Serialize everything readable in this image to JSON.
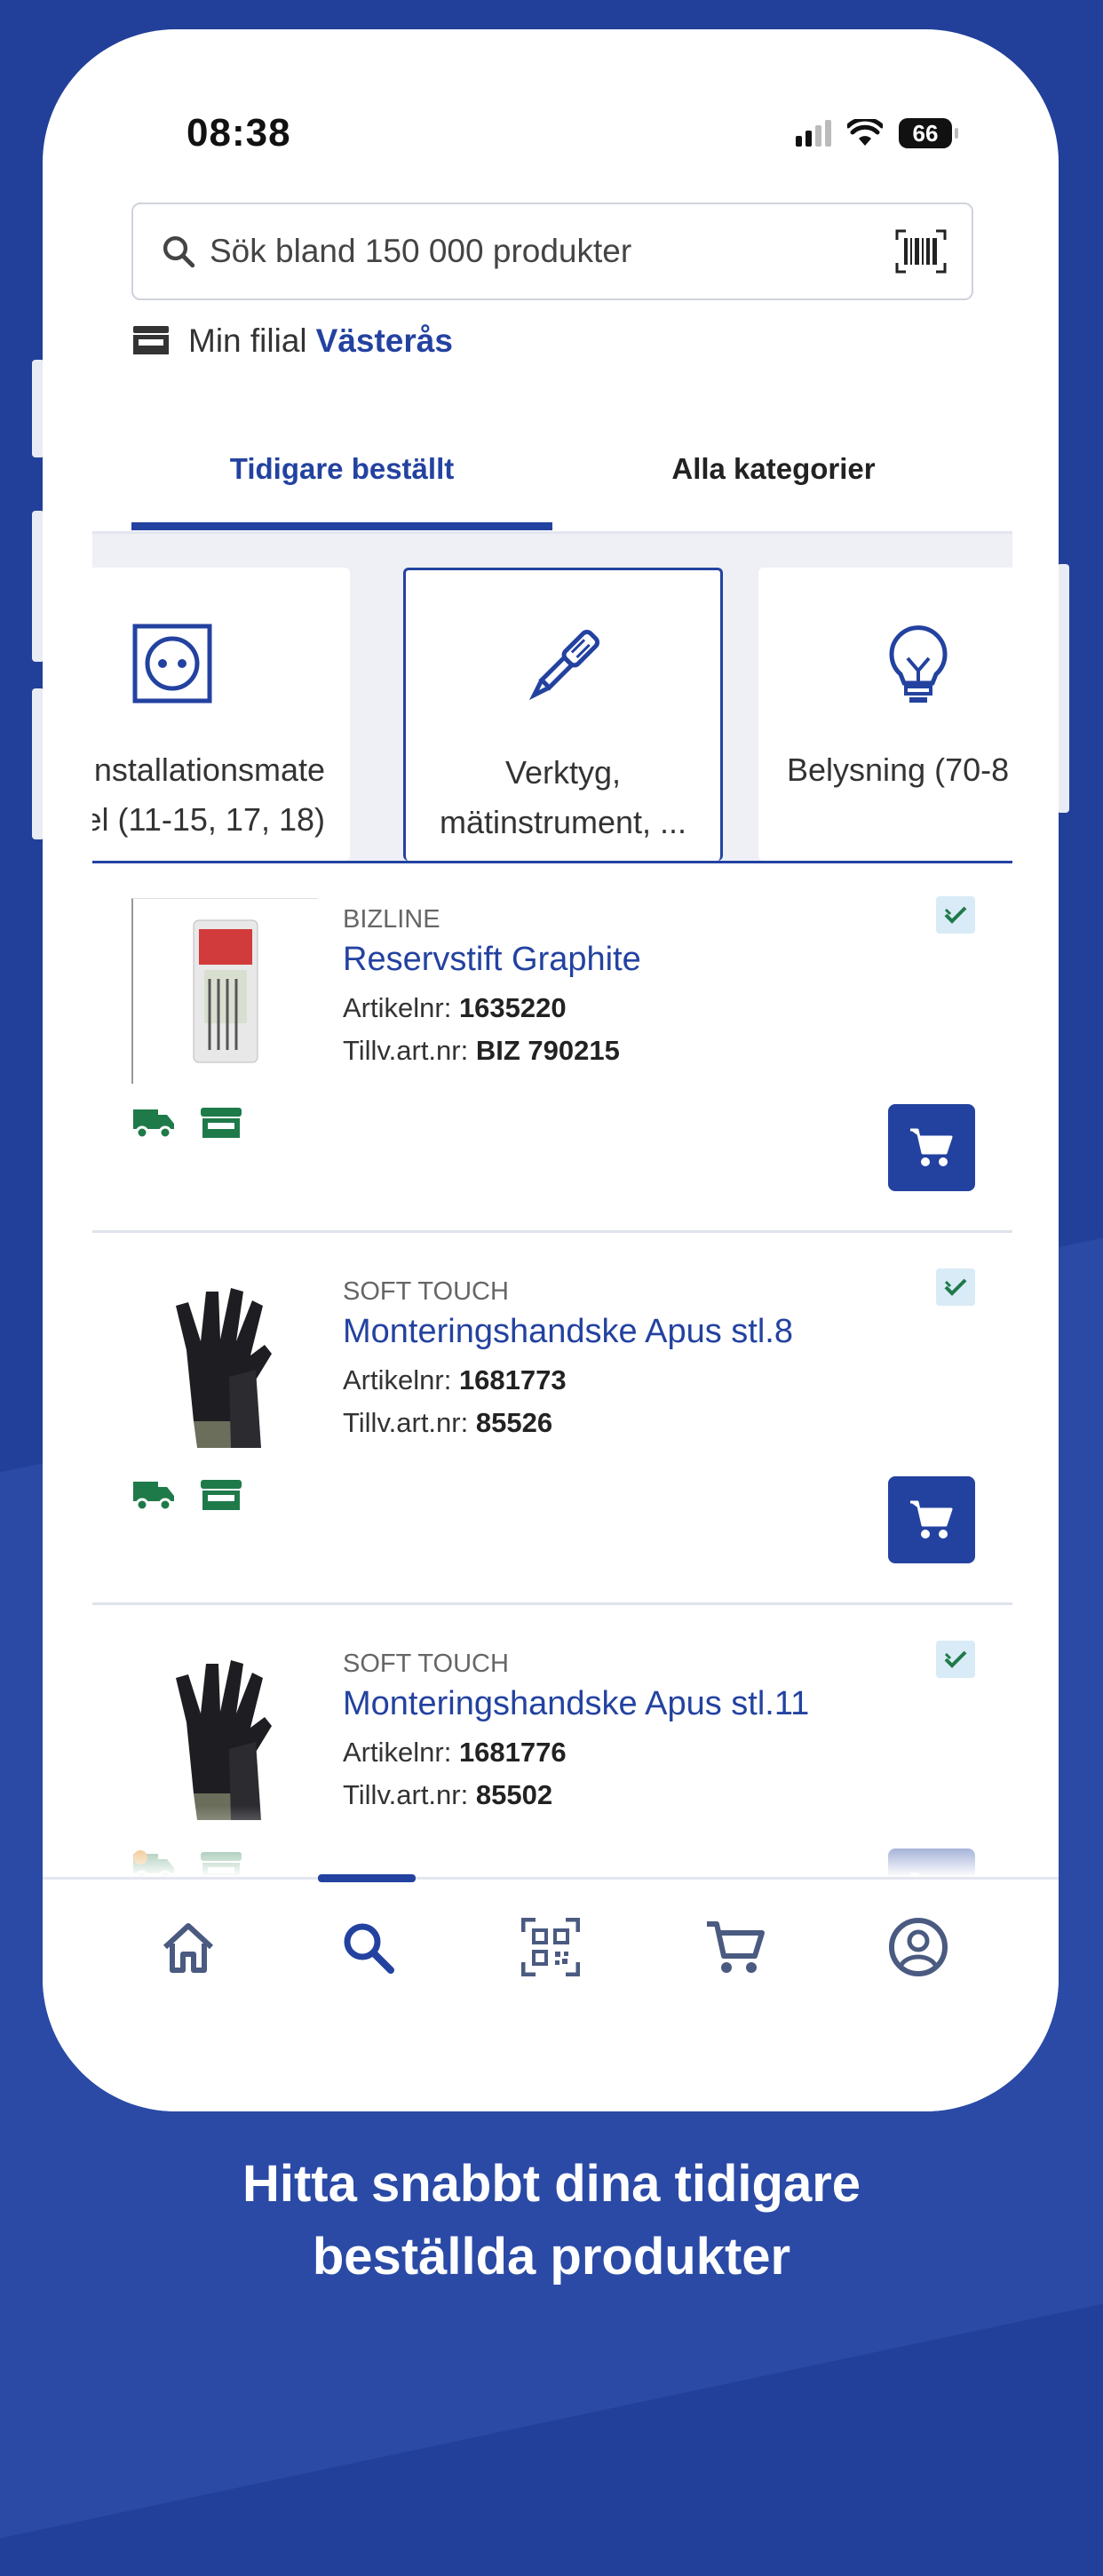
{
  "status": {
    "time": "08:38",
    "battery": "66"
  },
  "search": {
    "placeholder": "Sök bland 150 000 produkter"
  },
  "branch": {
    "label": "Min filial",
    "name": "Västerås"
  },
  "tabs": [
    {
      "label": "Tidigare beställt",
      "active": true
    },
    {
      "label": "Alla kategorier",
      "active": false
    }
  ],
  "categories": [
    {
      "label": "nstallationsmate\nel (11-15, 17, 18)",
      "icon": "socket-icon"
    },
    {
      "label": "Verktyg,\nmätinstrument, ...",
      "icon": "screwdriver-icon"
    },
    {
      "label": "Belysning (70-8",
      "icon": "lightbulb-icon"
    }
  ],
  "products": [
    {
      "brand": "BIZLINE",
      "name": "Reservstift Graphite",
      "artnr_label": "Artikelnr:",
      "artnr": "1635220",
      "tillv_label": "Tillv.art.nr:",
      "tillv": "BIZ 790215"
    },
    {
      "brand": "SOFT TOUCH",
      "name": "Monteringshandske Apus stl.8",
      "artnr_label": "Artikelnr:",
      "artnr": "1681773",
      "tillv_label": "Tillv.art.nr:",
      "tillv": "85526"
    },
    {
      "brand": "SOFT TOUCH",
      "name": "Monteringshandske Apus stl.11",
      "artnr_label": "Artikelnr:",
      "artnr": "1681776",
      "tillv_label": "Tillv.art.nr:",
      "tillv": "85502"
    }
  ],
  "nav": [
    "home-icon",
    "search-icon",
    "qr-code-icon",
    "cart-icon",
    "account-icon"
  ],
  "colors": {
    "brand": "#2342a0",
    "background": "#22409a",
    "available": "#1f7a4a"
  },
  "caption": "Hitta snabbt dina tidigare\nbeställda produkter"
}
